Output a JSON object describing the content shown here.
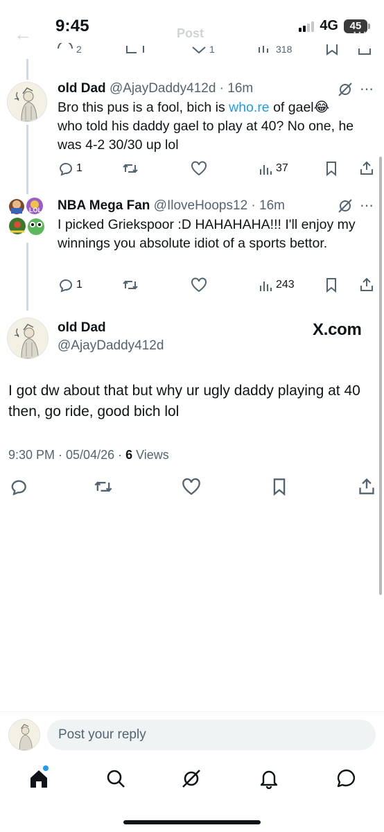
{
  "status_bar": {
    "time": "9:45",
    "network": "4G",
    "battery": "45"
  },
  "header": {
    "title": "Post"
  },
  "replies": [
    {
      "name": "old Dad",
      "handle": "@AjayDaddy412d",
      "time": "16m",
      "text_before_link": "Bro this pus is a fool, bich is ",
      "link": "who.re",
      "text_after_link": " of gael😂 who told his daddy gael to play at 40? No one, he was 4-2 30/30 up lol",
      "reply_count": "1",
      "views": "37"
    },
    {
      "name": "NBA Mega Fan",
      "handle": "@IloveHoops12",
      "time": "16m",
      "text": "I picked Griekspoor :D HAHAHAHA!!! I'll enjoy my winnings you absolute idiot of a sports bettor.",
      "reply_count": "1",
      "views": "243"
    }
  ],
  "main_post": {
    "name": "old Dad",
    "handle": "@AjayDaddy412d",
    "watermark": "X.com",
    "text": "I got dw about that but why ur ugly daddy playing at 40 then, go ride, good bich lol",
    "timestamp": "9:30 PM · 05/04/26 · ",
    "views_count": "6",
    "views_label": " Views"
  },
  "reply_bar": {
    "placeholder": "Post your reply"
  },
  "icons": {
    "reply": "reply-icon",
    "repost": "repost-icon",
    "like": "heart-icon",
    "views": "views-icon",
    "bookmark": "bookmark-icon",
    "share": "share-icon",
    "grok": "grok-icon",
    "home": "home-icon",
    "search": "search-icon",
    "notifications": "bell-icon",
    "messages": "messages-icon"
  },
  "colors": {
    "link": "#1d9bf0",
    "secondary_text": "#536471",
    "primary_text": "#0f1419",
    "unread_dot": "#1d9bf0"
  }
}
